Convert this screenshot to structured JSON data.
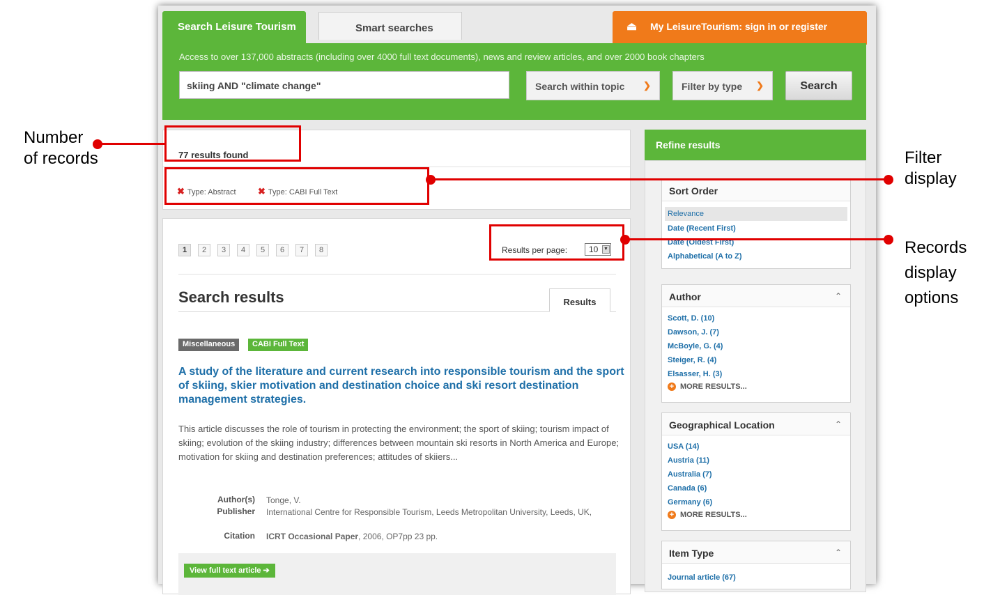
{
  "tabs": {
    "search": "Search Leisure Tourism",
    "smart": "Smart searches",
    "my": "My LeisureTourism: sign in or register"
  },
  "search_bar": {
    "access_text": "Access to over 137,000 abstracts (including over 4000 full text documents), news and review articles, and over 2000 book chapters",
    "query": "skiing AND \"climate change\"",
    "topic_select": "Search within topic",
    "type_select": "Filter by type",
    "button": "Search"
  },
  "results_header": {
    "count": "77 results found",
    "filters": [
      "Type: Abstract",
      "Type: CABI Full Text"
    ]
  },
  "pagination": {
    "pages": [
      "1",
      "2",
      "3",
      "4",
      "5",
      "6",
      "7",
      "8"
    ],
    "current": "1",
    "rpp_label": "Results per page:",
    "rpp_value": "10"
  },
  "results": {
    "title": "Search results",
    "tab": "Results",
    "item": {
      "badges": [
        "Miscellaneous",
        "CABI Full Text"
      ],
      "title": "A study of the literature and current research into responsible tourism and the sport of skiing, skier motivation and destination choice and ski resort destination management strategies.",
      "abstract": "This article discusses the role of tourism in protecting the environment; the sport of skiing; tourism impact of skiing; evolution of the skiing industry; differences between mountain ski resorts in North America and Europe; motivation for skiing and destination preferences; attitudes of skiiers...",
      "author_label": "Author(s)",
      "author": "Tonge, V.",
      "publisher_label": "Publisher",
      "publisher": "International Centre for Responsible Tourism, Leeds Metropolitan University, Leeds, UK,",
      "citation_label": "Citation",
      "citation_bold": "ICRT Occasional Paper",
      "citation_rest": ", 2006, OP7pp 23 pp.",
      "button": "View full text article ➔"
    }
  },
  "refine": {
    "header": "Refine results",
    "sort": {
      "title": "Sort Order",
      "items": [
        "Relevance",
        "Date (Recent First)",
        "Date (Oldest First)",
        "Alphabetical (A to Z)"
      ]
    },
    "author": {
      "title": "Author",
      "items": [
        "Scott, D. (10)",
        "Dawson, J. (7)",
        "McBoyle, G. (4)",
        "Steiger, R. (4)",
        "Elsasser, H. (3)"
      ],
      "more": "MORE RESULTS..."
    },
    "geo": {
      "title": "Geographical Location",
      "items": [
        "USA (14)",
        "Austria (11)",
        "Australia (7)",
        "Canada (6)",
        "Germany (6)"
      ],
      "more": "MORE RESULTS..."
    },
    "itemtype": {
      "title": "Item Type",
      "items": [
        "Journal article (67)"
      ]
    }
  },
  "annotations": {
    "records": "Number of records",
    "filter": "Filter display",
    "display": "Records display options"
  },
  "colors": {
    "green": "#5cb63a",
    "orange": "#f07a1a",
    "link": "#1e6fa8",
    "annotation": "#e00000"
  }
}
